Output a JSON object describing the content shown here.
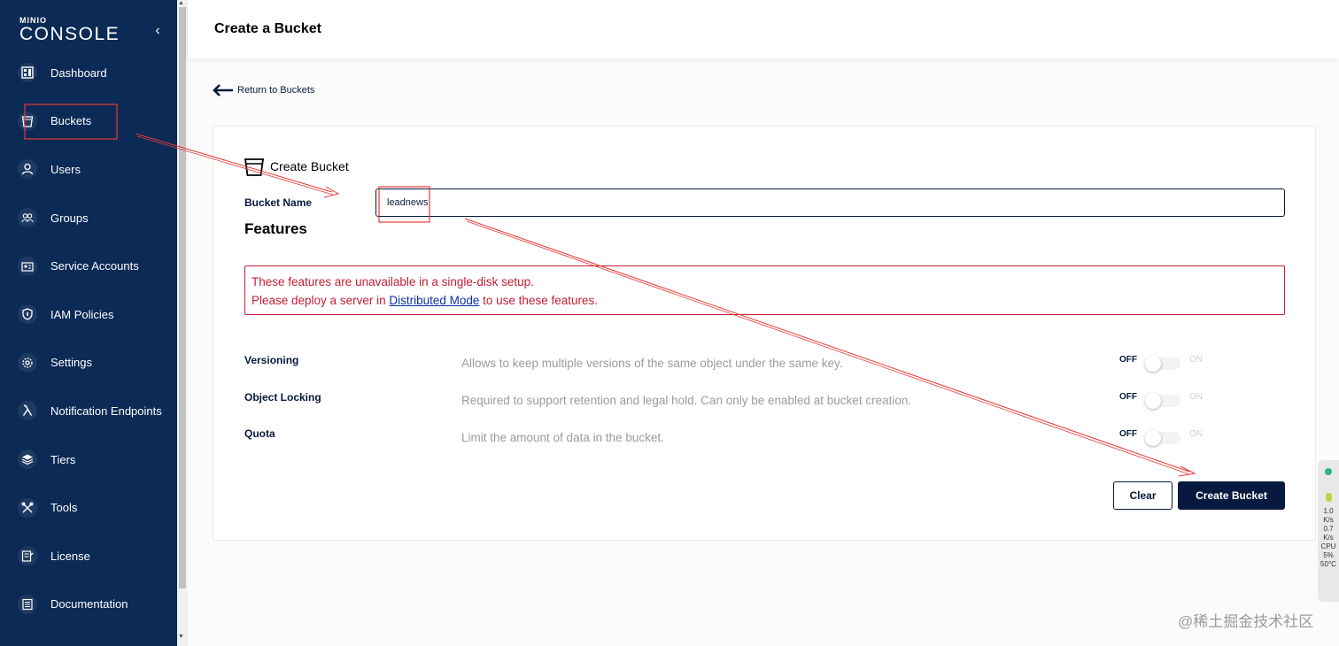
{
  "sidebar": {
    "logo_top": "MINIO",
    "logo_main": "CONSOLE",
    "collapse_glyph": "‹",
    "items": [
      {
        "label": "Dashboard",
        "icon": "dashboard-icon"
      },
      {
        "label": "Buckets",
        "icon": "bucket-icon"
      },
      {
        "label": "Users",
        "icon": "user-icon"
      },
      {
        "label": "Groups",
        "icon": "groups-icon"
      },
      {
        "label": "Service Accounts",
        "icon": "service-accounts-icon"
      },
      {
        "label": "IAM Policies",
        "icon": "shield-icon"
      },
      {
        "label": "Settings",
        "icon": "gear-icon"
      },
      {
        "label": "Notification Endpoints",
        "icon": "lambda-icon"
      },
      {
        "label": "Tiers",
        "icon": "layers-icon"
      },
      {
        "label": "Tools",
        "icon": "tools-icon"
      },
      {
        "label": "License",
        "icon": "license-icon"
      },
      {
        "label": "Documentation",
        "icon": "documentation-icon"
      }
    ]
  },
  "header": {
    "title": "Create a Bucket"
  },
  "back_link": {
    "label": "Return to Buckets"
  },
  "card": {
    "title": "Create Bucket",
    "bucket_name_label": "Bucket Name",
    "bucket_name_value": "leadnews",
    "features_title": "Features",
    "warning_line1": "These features are unavailable in a single-disk setup.",
    "warning_line2_prefix": "Please deploy a server in ",
    "warning_link": "Distributed Mode",
    "warning_line2_suffix": " to use these features.",
    "features": [
      {
        "label": "Versioning",
        "description": "Allows to keep multiple versions of the same object under the same key.",
        "off": "OFF",
        "on": "ON"
      },
      {
        "label": "Object Locking",
        "description": "Required to support retention and legal hold. Can only be enabled at bucket creation.",
        "off": "OFF",
        "on": "ON"
      },
      {
        "label": "Quota",
        "description": "Limit the amount of data in the bucket.",
        "off": "OFF",
        "on": "ON"
      }
    ],
    "clear_label": "Clear",
    "create_label": "Create Bucket"
  },
  "widget": {
    "v1": "1.0",
    "u1": "K/s",
    "v2": "0.7",
    "u2": "K/s",
    "cpu_label": "CPU",
    "cpu": "5",
    "cpu_unit": "%",
    "temp": "50",
    "temp_unit": "°C"
  },
  "watermark": "@稀土掘金技术社区",
  "colors": {
    "sidebar": "#0b2a55",
    "primary": "#07193e",
    "warning": "#c51d34",
    "annotation": "#e53935"
  }
}
